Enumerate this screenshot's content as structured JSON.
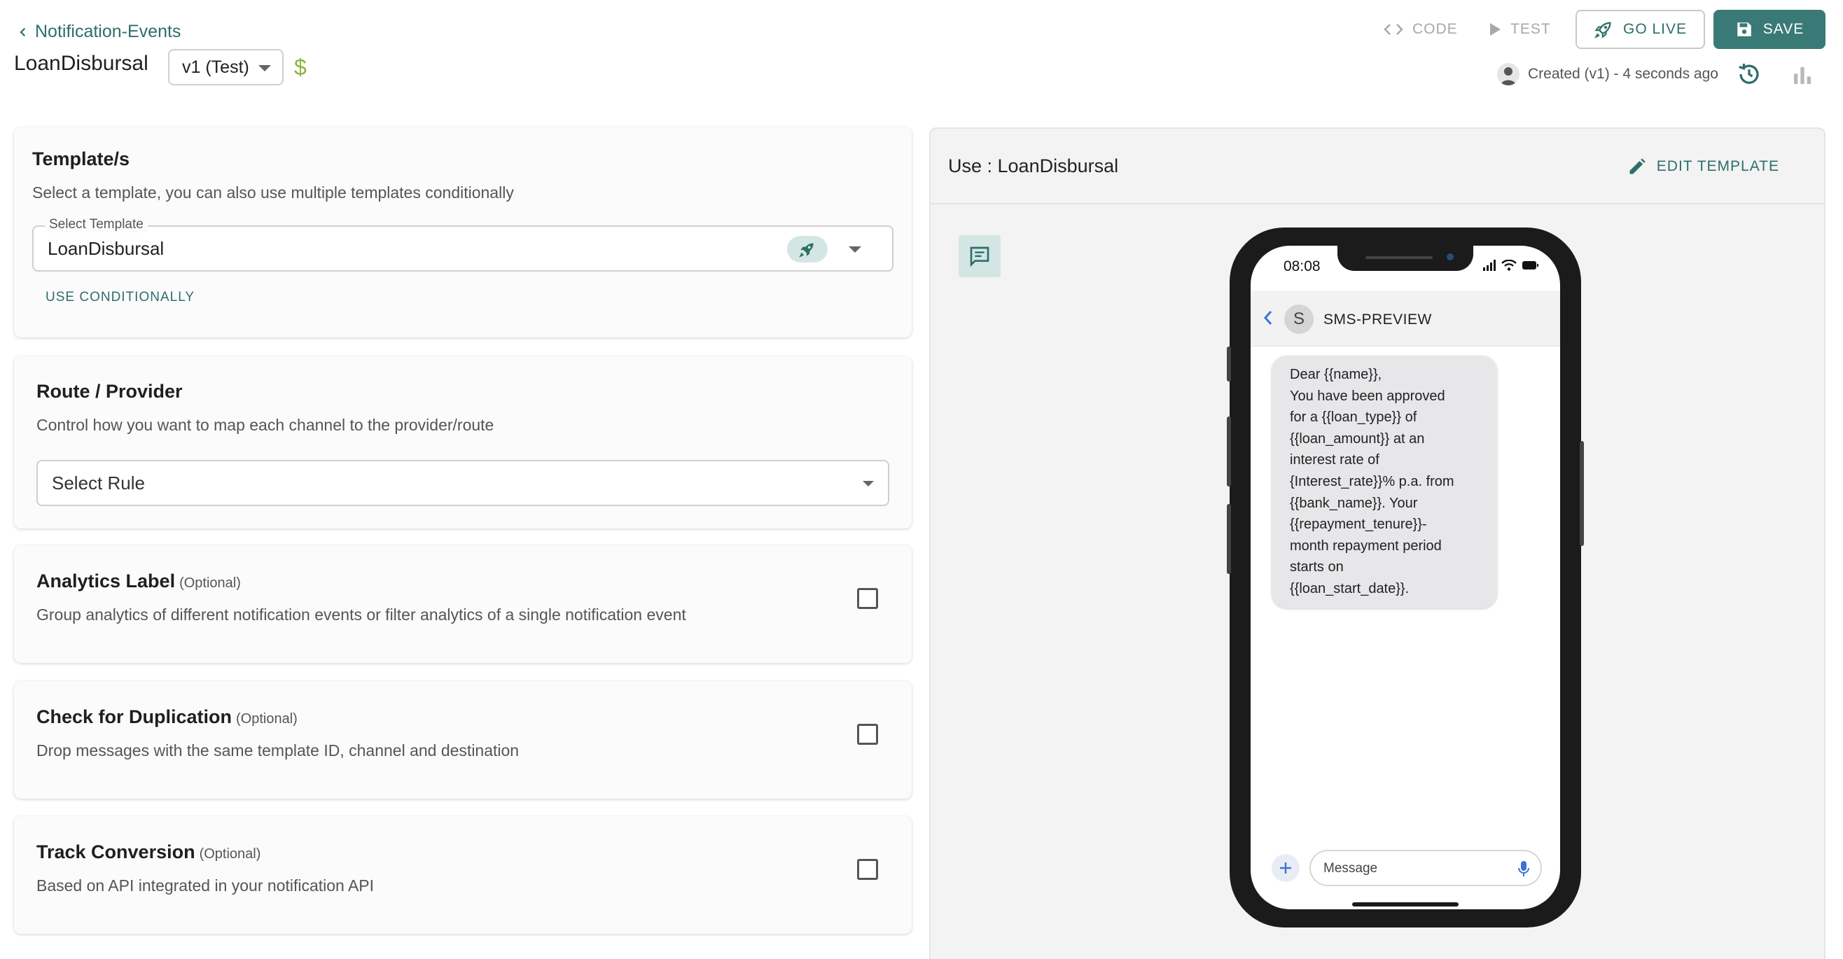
{
  "header": {
    "back_label": "Notification-Events",
    "title": "LoanDisbursal",
    "version": "v1 (Test)",
    "currency_symbol": "$",
    "actions": {
      "code": "CODE",
      "test": "TEST",
      "go_live": "GO LIVE",
      "save": "SAVE"
    },
    "created_info": "Created (v1) - 4 seconds ago"
  },
  "template_card": {
    "title": "Template/s",
    "description": "Select a template, you can also use multiple templates conditionally",
    "field_label": "Select Template",
    "selected": "LoanDisbursal",
    "use_conditionally": "USE CONDITIONALLY"
  },
  "route_card": {
    "title": "Route / Provider",
    "description": "Control how you want to map each channel to the provider/route",
    "placeholder": "Select Rule"
  },
  "analytics_card": {
    "title": "Analytics Label",
    "optional": "(Optional)",
    "description": "Group analytics of different notification events or filter analytics of a single notification event"
  },
  "duplication_card": {
    "title": "Check for Duplication",
    "optional": "(Optional)",
    "description": "Drop messages with the same template ID, channel and destination"
  },
  "conversion_card": {
    "title": "Track Conversion",
    "optional": "(Optional)",
    "description": "Based on API integrated in your notification API"
  },
  "preview": {
    "use_label": "Use : LoanDisbursal",
    "edit_template": "EDIT TEMPLATE",
    "phone": {
      "time": "08:08",
      "contact_initial": "S",
      "contact_name": "SMS-PREVIEW",
      "message": "Dear {{name}},\nYou have been approved\nfor a {{loan_type}} of\n{{loan_amount}} at an\ninterest rate of\n{Interest_rate}}% p.a. from\n{{bank_name}}. Your\n{{repayment_tenure}}-\nmonth repayment period\nstarts on\n{{loan_start_date}}.",
      "input_placeholder": "Message"
    }
  },
  "colors": {
    "accent": "#2d6e6a",
    "save_bg": "#3a7a76",
    "dollar": "#8ab43e",
    "panel_bg": "#f3f3f3"
  }
}
